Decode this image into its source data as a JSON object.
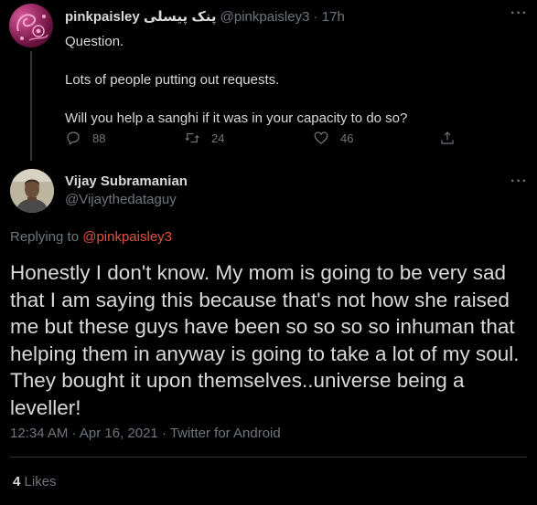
{
  "parent_tweet": {
    "display_name": "pinkpaisley",
    "display_name_urdu": "پنک پیسلی",
    "handle": "@pinkpaisley3",
    "separator": "·",
    "time_ago": "17h",
    "lines": [
      "Question.",
      "Lots of people putting out requests.",
      "Will you help a sanghi if it was in your capacity to do so?"
    ],
    "replies": "88",
    "retweets": "24",
    "likes": "46"
  },
  "main_tweet": {
    "display_name": "Vijay Subramanian",
    "handle": "@Vijaythedataguy",
    "replying_prefix": "Replying to",
    "replying_to": "@pinkpaisley3",
    "text": "Honestly I don't know. My mom is going to be very sad that I am saying this because that's not how she raised me but these guys have been so so so so inhuman that helping them in anyway is going to take a lot of my soul. They bought it upon themselves..universe being a leveller!",
    "timestamp": "12:34 AM · Apr 16, 2021 · Twitter for Android",
    "likes_count": "4",
    "likes_label": "Likes"
  },
  "more_label": "···",
  "colors": {
    "background": "#000000",
    "text": "#d9d9d9",
    "muted": "#6e767d",
    "mention": "#e0533d",
    "divider": "#2f3336"
  },
  "icons": [
    "reply-icon",
    "retweet-icon",
    "like-icon",
    "share-icon",
    "more-icon"
  ]
}
